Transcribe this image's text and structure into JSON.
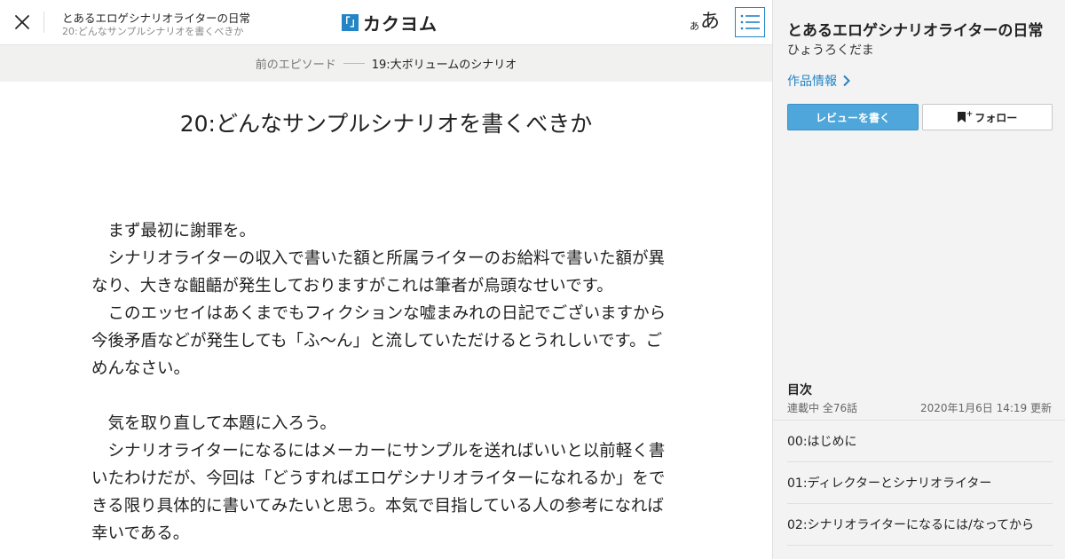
{
  "header": {
    "work_title": "とあるエロゲシナリオライターの日常",
    "episode_subtitle": "20:どんなサンプルシナリオを書くべきか",
    "logo_mark": "「」",
    "logo_text": "カクヨム",
    "font_size_small": "あ",
    "font_size_large": "あ",
    "close_icon": "close-icon",
    "toc_icon": "list-icon"
  },
  "prev_episode": {
    "label": "前のエピソード",
    "title": "19:大ボリュームのシナリオ"
  },
  "episode": {
    "title": "20:どんなサンプルシナリオを書くべきか",
    "paragraphs": [
      "　まず最初に謝罪を。",
      "　シナリオライターの収入で書いた額と所属ライターのお給料で書いた額が異なり、大きな齟齬が発生しておりますがこれは筆者が烏頭なせいです。",
      "　このエッセイはあくまでもフィクションな嘘まみれの日記でございますから今後矛盾などが発生しても「ふ～ん」と流していただけるとうれしいです。ごめんなさい。",
      "",
      "　気を取り直して本題に入ろう。",
      "　シナリオライターになるにはメーカーにサンプルを送ればいいと以前軽く書いたわけだが、今回は「どうすればエロゲシナリオライターになれるか」をできる限り具体的に書いてみたいと思う。本気で目指している人の参考になれば幸いである。"
    ]
  },
  "sidebar": {
    "work_title": "とあるエロゲシナリオライターの日常",
    "author": "ひょうろくだま",
    "info_link": "作品情報",
    "review_button": "レビューを書く",
    "follow_button": "フォロー",
    "follow_plus": "+",
    "toc_heading": "目次",
    "toc_status": "連載中 全76話",
    "toc_updated": "2020年1月6日 14:19 更新",
    "accent_color": "#2384c6",
    "toc_items": [
      "00:はじめに",
      "01:ディレクターとシナリオライター",
      "02:シナリオライターになるには/なってから"
    ]
  }
}
